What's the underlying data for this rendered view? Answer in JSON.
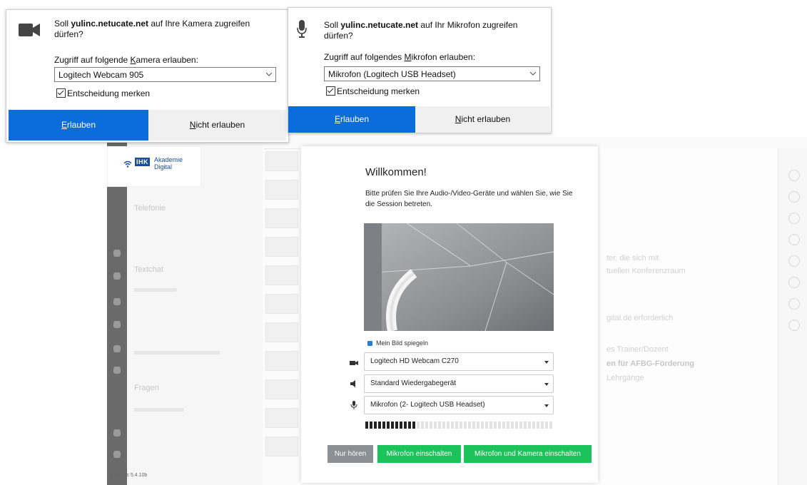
{
  "camera_dialog": {
    "question_prefix": "Soll ",
    "site": "yulinc.netucate.net",
    "question_suffix": " auf Ihre Kamera zugreifen dürfen?",
    "label_pre": "Zugriff auf folgende ",
    "label_key": "K",
    "label_post": "amera erlauben:",
    "selected_device": "Logitech Webcam 905",
    "remember_label": "Entscheidung merken",
    "allow_label_key": "E",
    "allow_label_rest": "rlauben",
    "deny_label_key": "N",
    "deny_label_rest": "icht erlauben",
    "icon": "camera-icon"
  },
  "microphone_dialog": {
    "question_prefix": "Soll ",
    "site": "yulinc.netucate.net",
    "question_suffix": " auf Ihr Mikrofon zugreifen dürfen?",
    "label_pre": "Zugriff auf folgendes ",
    "label_key": "M",
    "label_post": "ikrofon erlauben:",
    "selected_device": "Mikrofon (Logitech USB Headset)",
    "remember_label": "Entscheidung merken",
    "allow_label_key": "E",
    "allow_label_rest": "rlauben",
    "deny_label_key": "N",
    "deny_label_rest": "icht erlauben",
    "icon": "microphone-icon"
  },
  "welcome_modal": {
    "title": "Willkommen!",
    "description": "Bitte prüfen Sie Ihre Audio-/Video-Geräte und wählen Sie, wie Sie die Session betreten.",
    "mirror_label": "Mein Bild spiegeln",
    "camera_device": "Logitech HD Webcam C270",
    "speaker_device": "Standard Wiedergabegerät",
    "microphone_device": "Mikrofon (2- Logitech USB Headset)",
    "mic_level": 0.27,
    "buttons": {
      "listen_only": "Nur hören",
      "mic_on": "Mikrofon einschalten",
      "mic_and_cam_on": "Mikrofon und Kamera einschalten"
    },
    "colors": {
      "listen_only": "#8a9094",
      "green": "#1cc35a"
    }
  },
  "brand": {
    "badge": "IHK",
    "line1": "Akademie",
    "line2": "Digital"
  },
  "footer": {
    "version": "© YuLinc 5.4.10b"
  },
  "background_blurred": {
    "sidebar_headings": [
      "Telefonie",
      "Textchat",
      "Fragen"
    ],
    "content_lines": [
      "ter, die sich mit",
      "tuellen Konferenzraum",
      "gital.de erforderlich",
      "es Trainer/Dozent",
      "en für AFBG-Förderung",
      "Lehrgänge"
    ]
  }
}
